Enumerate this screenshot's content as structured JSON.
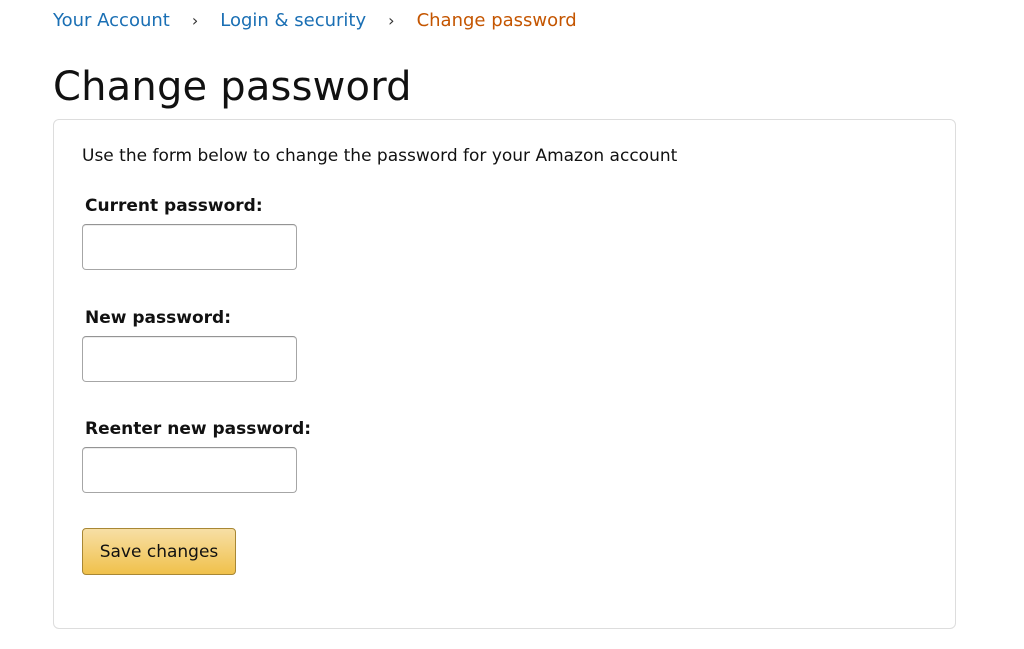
{
  "breadcrumb": {
    "items": [
      {
        "label": "Your Account"
      },
      {
        "label": "Login & security"
      },
      {
        "label": "Change password"
      }
    ],
    "separator": "›"
  },
  "page": {
    "title": "Change password"
  },
  "form": {
    "intro": "Use the form below to change the password for your Amazon account",
    "fields": [
      {
        "label": "Current password:",
        "value": "",
        "placeholder": ""
      },
      {
        "label": "New password:",
        "value": "",
        "placeholder": ""
      },
      {
        "label": "Reenter new password:",
        "value": "",
        "placeholder": ""
      }
    ],
    "save_label": "Save changes"
  },
  "colors": {
    "link": "#1a6fb4",
    "current_crumb": "#c45500",
    "button_top": "#f7dfa5",
    "button_bottom": "#f0c14b"
  }
}
